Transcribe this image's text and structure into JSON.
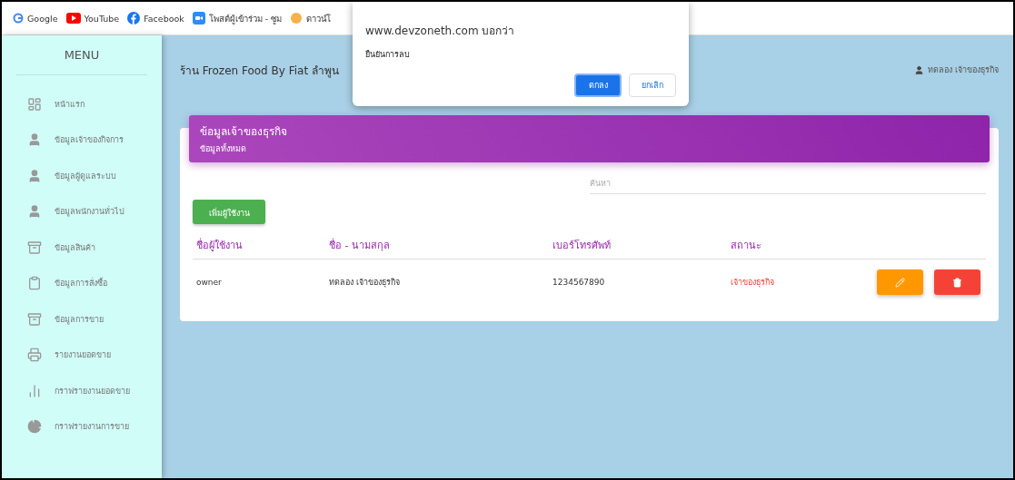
{
  "bookmarks": [
    {
      "kind": "google",
      "label": "Google"
    },
    {
      "kind": "youtube",
      "label": "YouTube"
    },
    {
      "kind": "facebook",
      "label": "Facebook"
    },
    {
      "kind": "zoom",
      "label": "โพสต์ผู้เข้าร่วม - ซูม"
    },
    {
      "kind": "orange",
      "label": "ดาวน์โ"
    }
  ],
  "sidebar": {
    "title": "MENU",
    "items": [
      {
        "kind": "dashboard",
        "label": "หน้าแรก"
      },
      {
        "kind": "person",
        "label": "ข้อมูลเจ้าของกิจการ"
      },
      {
        "kind": "person",
        "label": "ข้อมูลผู้ดูแลระบบ"
      },
      {
        "kind": "person",
        "label": "ข้อมูลพนักงานทั่วไป"
      },
      {
        "kind": "archive",
        "label": "ข้อมูลสินค้า"
      },
      {
        "kind": "clipboard",
        "label": "ข้อมูลการสั่งซื้อ"
      },
      {
        "kind": "archive",
        "label": "ข้อมูลการขาย"
      },
      {
        "kind": "printer",
        "label": "รายงานยอดขาย"
      },
      {
        "kind": "bars",
        "label": "กราฟรายงานยอดขาย"
      },
      {
        "kind": "pie",
        "label": "กราฟรายงานการขาย"
      }
    ]
  },
  "header": {
    "shop_name": "ร้าน Frozen Food By Fiat ลำพูน",
    "user": "ทดลอง เจ้าของธุรกิจ"
  },
  "card": {
    "title": "ข้อมูลเจ้าของธุรกิจ",
    "subtitle": "ข้อมูลทั้งหมด",
    "search": {
      "placeholder": "ค้นหา"
    },
    "add_button": "เพิ่มผู้ใช้งาน",
    "table": {
      "columns": [
        "ชื่อผู้ใช้งาน",
        "ชื่อ - นามสกุล",
        "เบอร์โทรศัพท์",
        "สถานะ"
      ],
      "rows": [
        {
          "cells": [
            "owner",
            "ทดลอง เจ้าของธุรกิจ",
            "1234567890",
            "เจ้าของธุรกิจ"
          ]
        }
      ]
    }
  },
  "dialog": {
    "title": "www.devzoneth.com บอกว่า",
    "message": "ยืนยันการลบ",
    "buttons": [
      {
        "label": "ตกลง",
        "kind": "primary"
      },
      {
        "label": "ยกเลิก",
        "kind": "secondary"
      }
    ]
  }
}
